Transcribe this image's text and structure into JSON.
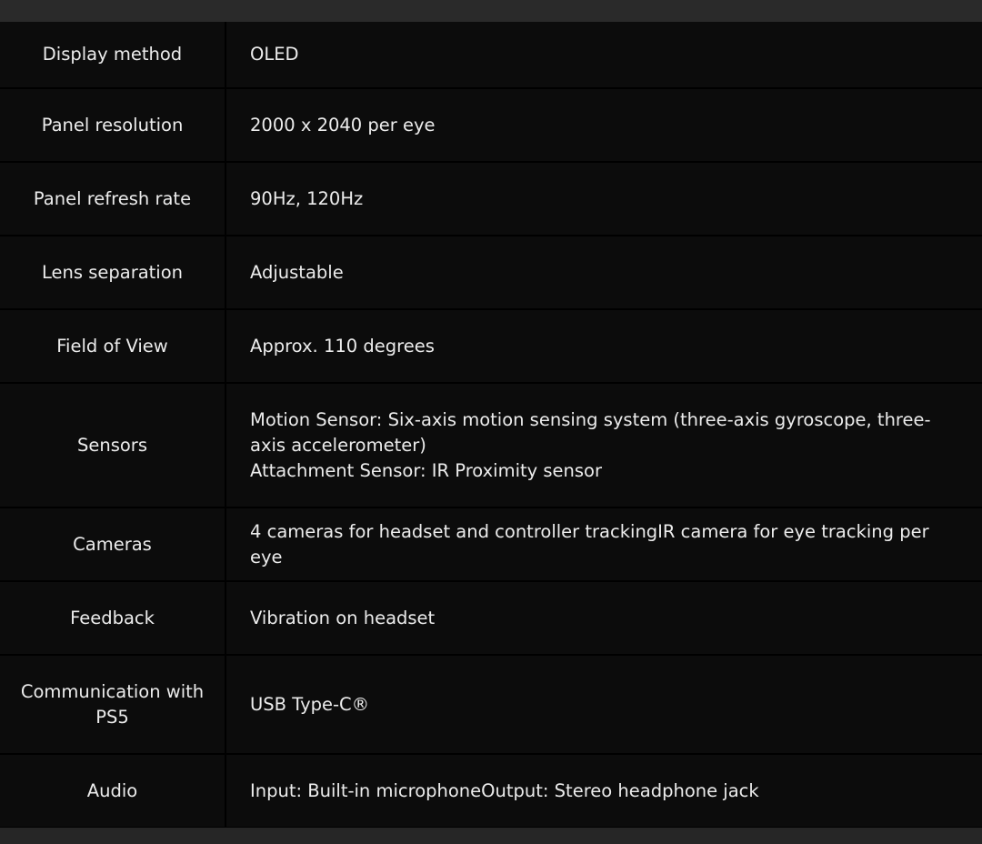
{
  "specs": [
    {
      "label": "Display method",
      "value": "OLED"
    },
    {
      "label": "Panel resolution",
      "value": "2000 x 2040 per eye"
    },
    {
      "label": "Panel refresh rate",
      "value": "90Hz, 120Hz"
    },
    {
      "label": "Lens separation",
      "value": "Adjustable"
    },
    {
      "label": "Field of View",
      "value": "Approx. 110 degrees"
    },
    {
      "label": "Sensors",
      "value": "Motion Sensor: Six-axis motion sensing system (three-axis gyroscope, three-axis accelerometer)\nAttachment Sensor: IR Proximity sensor"
    },
    {
      "label": "Cameras",
      "value": "4 cameras for headset and controller trackingIR camera for eye tracking per eye"
    },
    {
      "label": "Feedback",
      "value": "Vibration on headset"
    },
    {
      "label": "Communication with PS5",
      "value": "USB Type-C®"
    },
    {
      "label": "Audio",
      "value": "Input: Built-in microphoneOutput: Stereo headphone jack"
    }
  ]
}
